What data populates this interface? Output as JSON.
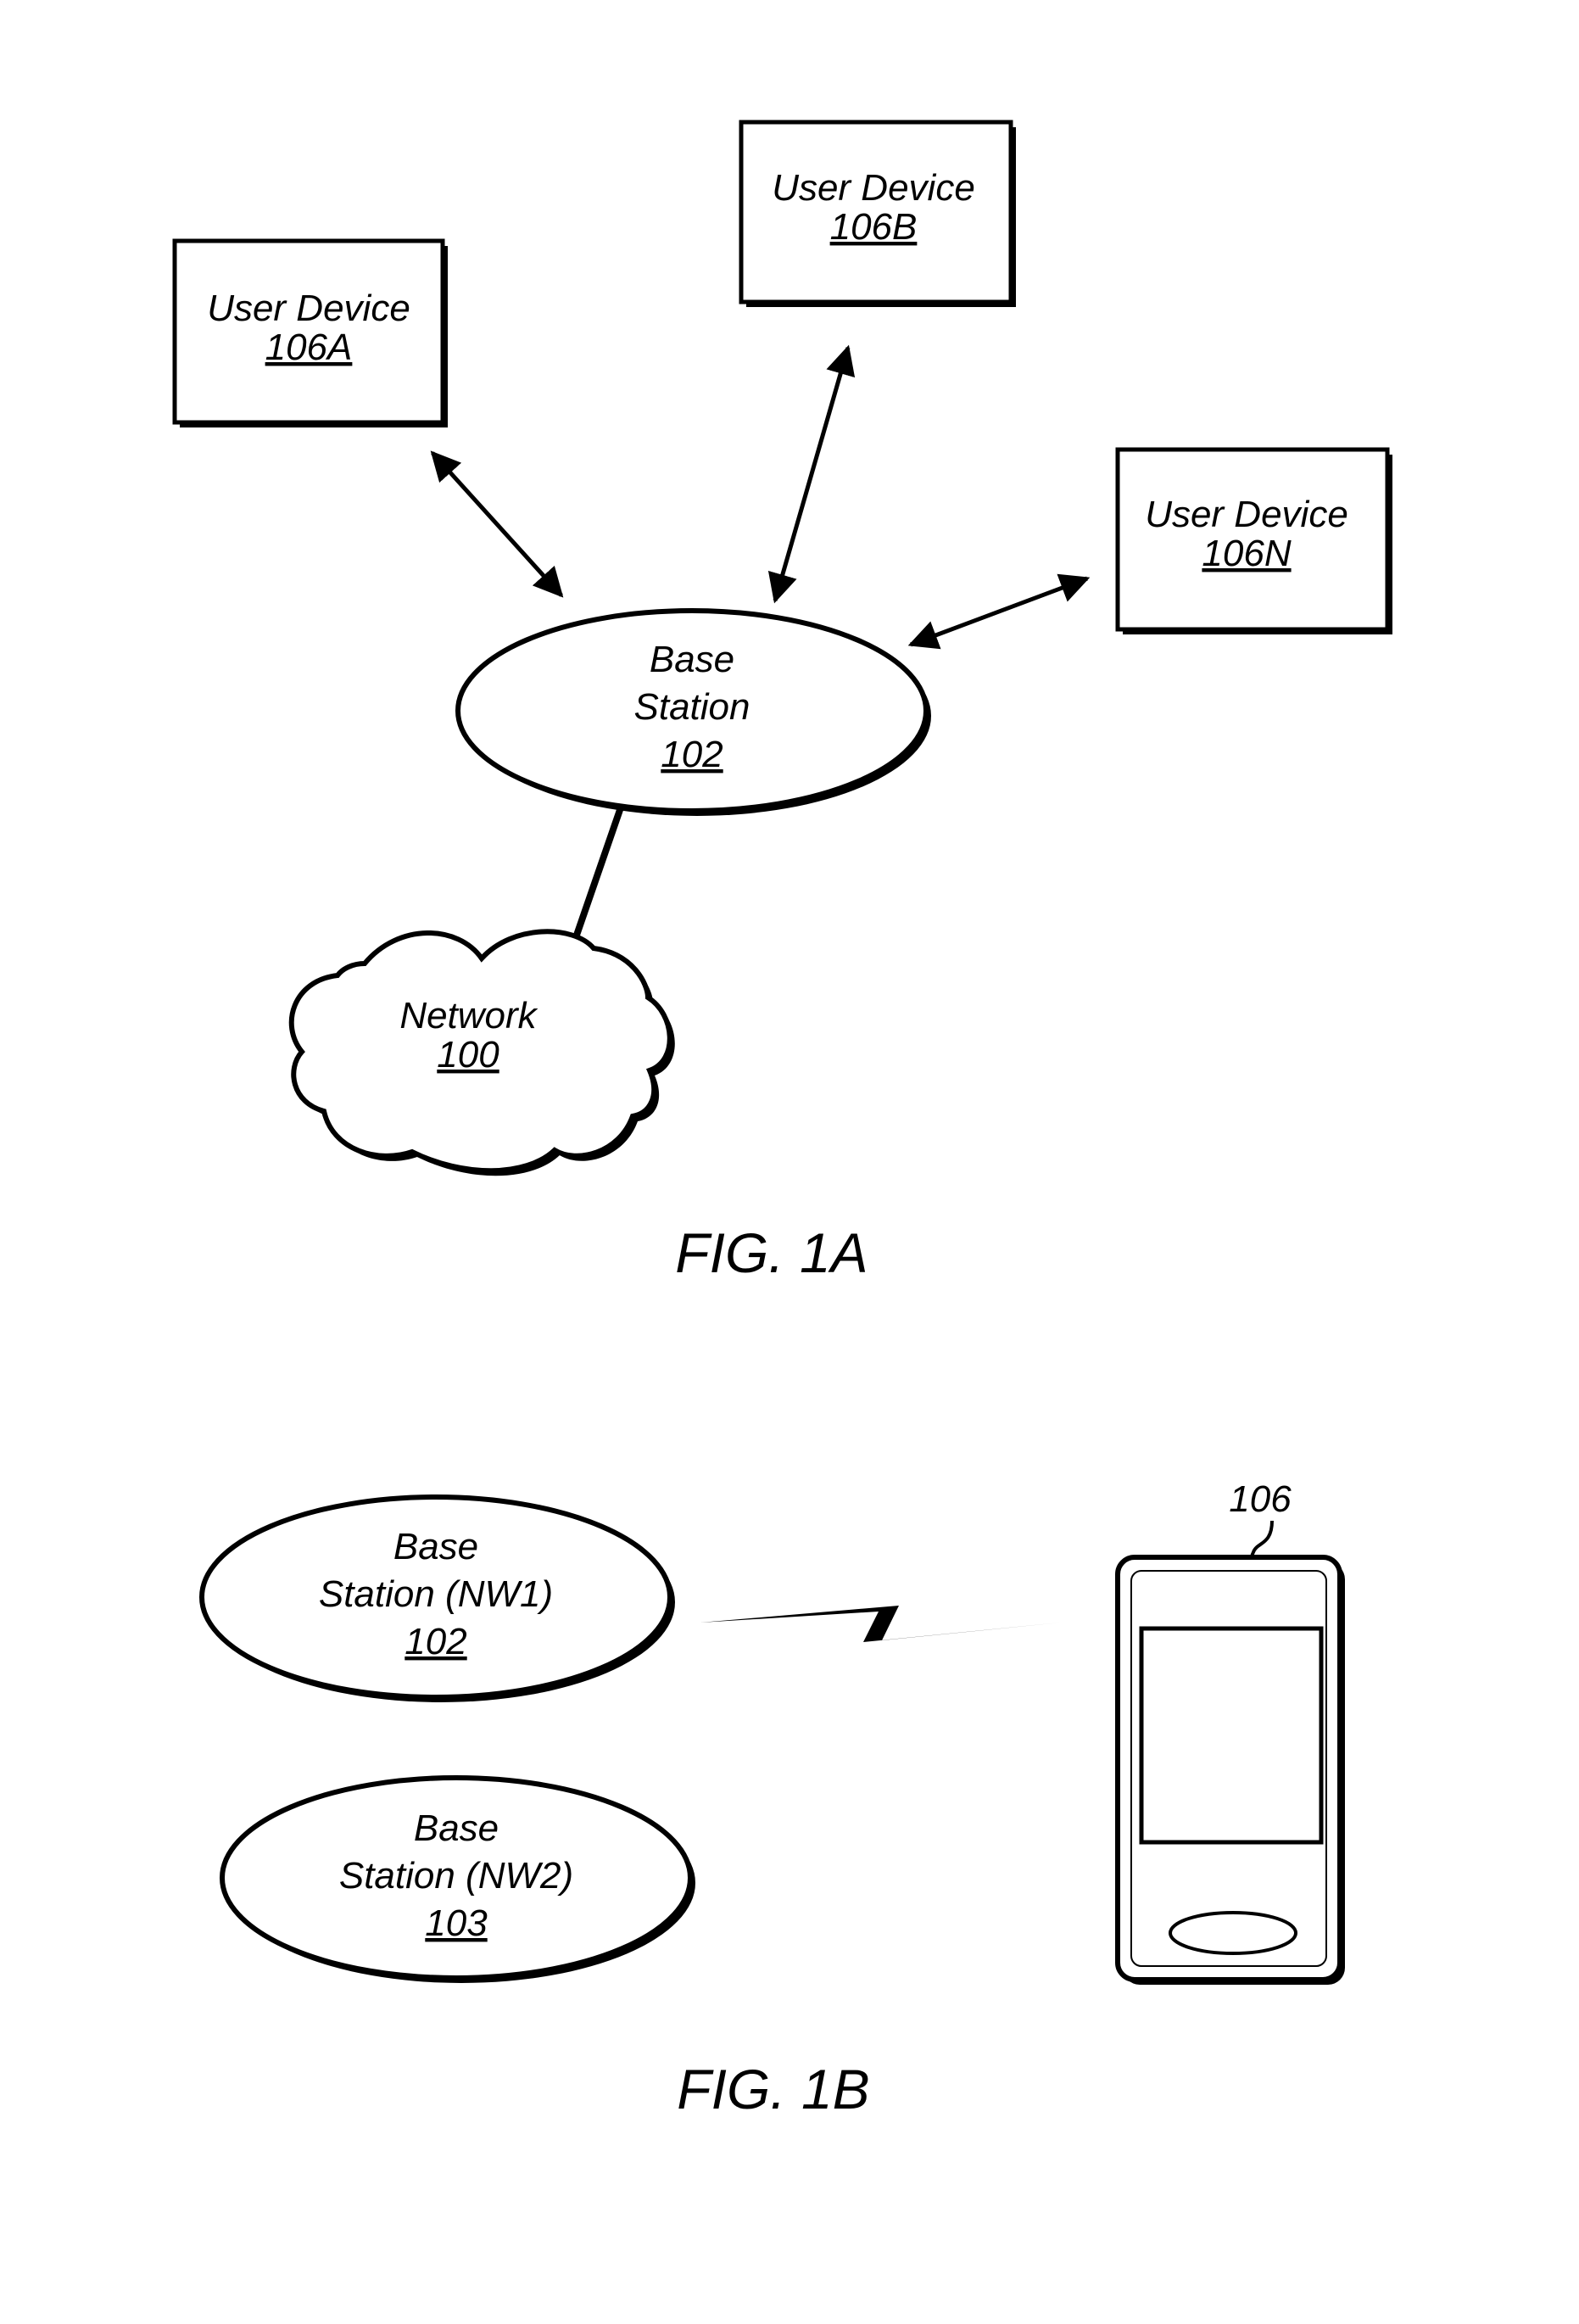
{
  "fig1a": {
    "caption": "FIG. 1A",
    "user_devices": [
      {
        "title": "User Device",
        "ref": "106A"
      },
      {
        "title": "User Device",
        "ref": "106B"
      },
      {
        "title": "User Device",
        "ref": "106N"
      }
    ],
    "base_station": {
      "line1": "Base",
      "line2": "Station",
      "ref": "102"
    },
    "network": {
      "title": "Network",
      "ref": "100"
    }
  },
  "fig1b": {
    "caption": "FIG. 1B",
    "base_station_nw1": {
      "line1": "Base",
      "line2": "Station (NW1)",
      "ref": "102"
    },
    "base_station_nw2": {
      "line1": "Base",
      "line2": "Station (NW2)",
      "ref": "103"
    },
    "device_ref": "106"
  },
  "colors": {
    "ink": "#000000",
    "paper": "#ffffff"
  }
}
